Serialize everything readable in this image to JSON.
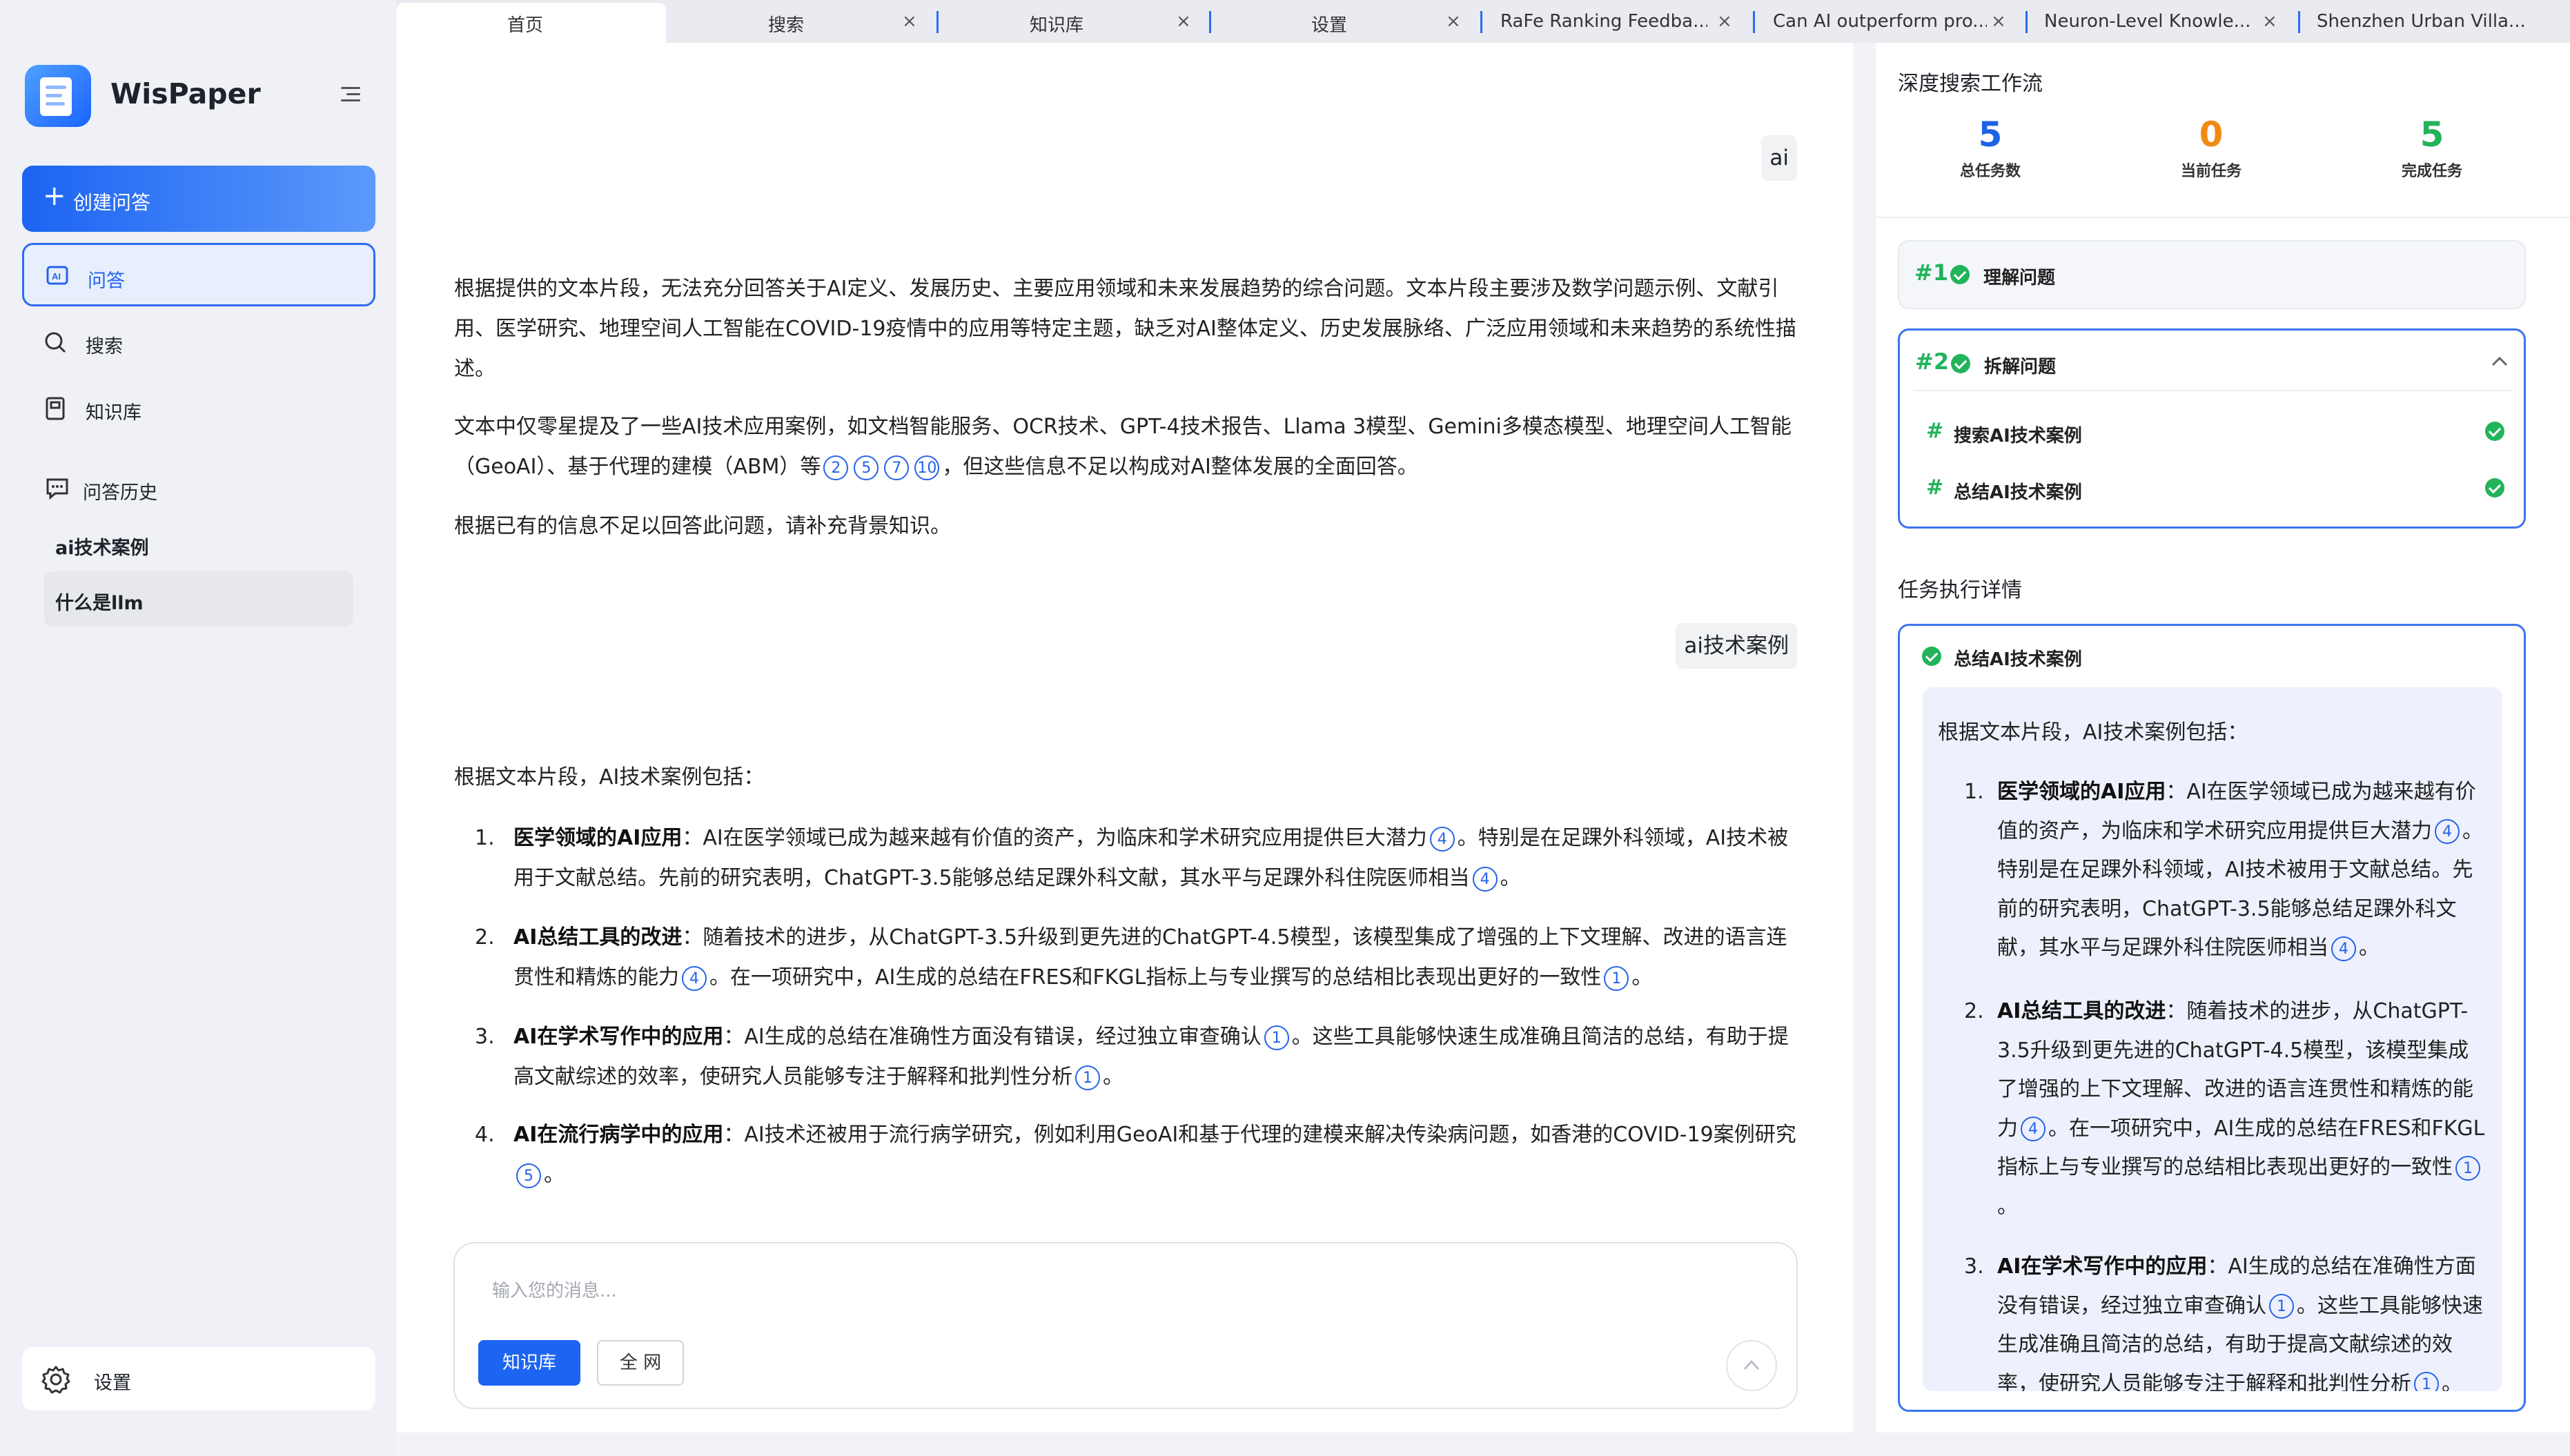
{
  "app": {
    "name": "WisPaper"
  },
  "sidebar": {
    "create_label": "创建问答",
    "nav": [
      {
        "label": "问答"
      },
      {
        "label": "搜索"
      },
      {
        "label": "知识库"
      }
    ],
    "history_title": "问答历史",
    "history": [
      {
        "label": "ai技术案例"
      },
      {
        "label": "什么是llm"
      }
    ],
    "settings_label": "设置"
  },
  "tabs": [
    {
      "label": "首页"
    },
    {
      "label": "搜索"
    },
    {
      "label": "知识库"
    },
    {
      "label": "设置"
    },
    {
      "label": "RaFe Ranking Feedba..."
    },
    {
      "label": "Can AI outperform pro..."
    },
    {
      "label": "Neuron-Level Knowle..."
    },
    {
      "label": "Shenzhen Urban Villa..."
    }
  ],
  "chat": {
    "user_msg_1": "ai",
    "answer1": {
      "p1": "根据提供的文本片段，无法充分回答关于AI定义、发展历史、主要应用领域和未来发展趋势的综合问题。文本片段主要涉及数学问题示例、文献引用、医学研究、地理空间人工智能在COVID-19疫情中的应用等特定主题，缺乏对AI整体定义、历史发展脉络、广泛应用领域和未来趋势的系统性描述。",
      "p2": "文本中仅零星提及了一些AI技术应用案例，如文档智能服务、OCR技术、GPT-4技术报告、Llama 3模型、Gemini多模态模型、地理空间人工智能（GeoAI）、基于代理的建模（ABM）等",
      "p2_cites": [
        "2",
        "5",
        "7",
        "10"
      ],
      "p2_end": "，但这些信息不足以构成对AI整体发展的全面回答。",
      "p3": "根据已有的信息不足以回答此问题，请补充背景知识。"
    },
    "user_msg_2": "ai技术案例",
    "answer2": {
      "intro": "根据文本片段，AI技术案例包括：",
      "items": [
        {
          "num": "1.",
          "title": "医学领域的AI应用",
          "a": "：AI在医学领域已成为越来越有价值的资产，为临床和学术研究应用提供巨大潜力",
          "c1": "4",
          "b": "。特别是在足踝外科领域，AI技术被用于文献总结。先前的研究表明，ChatGPT-3.5能够总结足踝外科文献，其水平与足踝外科住院医师相当",
          "c2": "4",
          "end": "。"
        },
        {
          "num": "2.",
          "title": "AI总结工具的改进",
          "a": "：随着技术的进步，从ChatGPT-3.5升级到更先进的ChatGPT-4.5模型，该模型集成了增强的上下文理解、改进的语言连贯性和精炼的能力",
          "c1": "4",
          "b": "。在一项研究中，AI生成的总结在FRES和FKGL指标上与专业撰写的总结相比表现出更好的一致性",
          "c2": "1",
          "end": "。"
        },
        {
          "num": "3.",
          "title": "AI在学术写作中的应用",
          "a": "：AI生成的总结在准确性方面没有错误，经过独立审查确认",
          "c1": "1",
          "b": "。这些工具能够快速生成准确且简洁的总结，有助于提高文献综述的效率，使研究人员能够专注于解释和批判性分析",
          "c2": "1",
          "end": "。"
        },
        {
          "num": "4.",
          "title": "AI在流行病学中的应用",
          "a": "：AI技术还被用于流行病学研究，例如利用GeoAI和基于代理的建模来解决传染病问题，如香港的COVID-19案例研究",
          "c1": "5",
          "b": "",
          "c2": "",
          "end": "。"
        }
      ]
    },
    "input_placeholder": "输入您的消息...",
    "kb_button": "知识库",
    "web_button": "全 网"
  },
  "workflow": {
    "title": "深度搜索工作流",
    "stats": [
      {
        "value": "5",
        "label": "总任务数",
        "color": "#1d63e8"
      },
      {
        "value": "0",
        "label": "当前任务",
        "color": "#f08a15"
      },
      {
        "value": "5",
        "label": "完成任务",
        "color": "#22b35b"
      }
    ],
    "steps": [
      {
        "num": "#1",
        "label": "理解问题"
      },
      {
        "num": "#2",
        "label": "拆解问题",
        "subs": [
          {
            "label": "搜索AI技术案例"
          },
          {
            "label": "总结AI技术案例"
          }
        ]
      }
    ],
    "detail_title": "任务执行详情",
    "detail_task": "总结AI技术案例"
  }
}
